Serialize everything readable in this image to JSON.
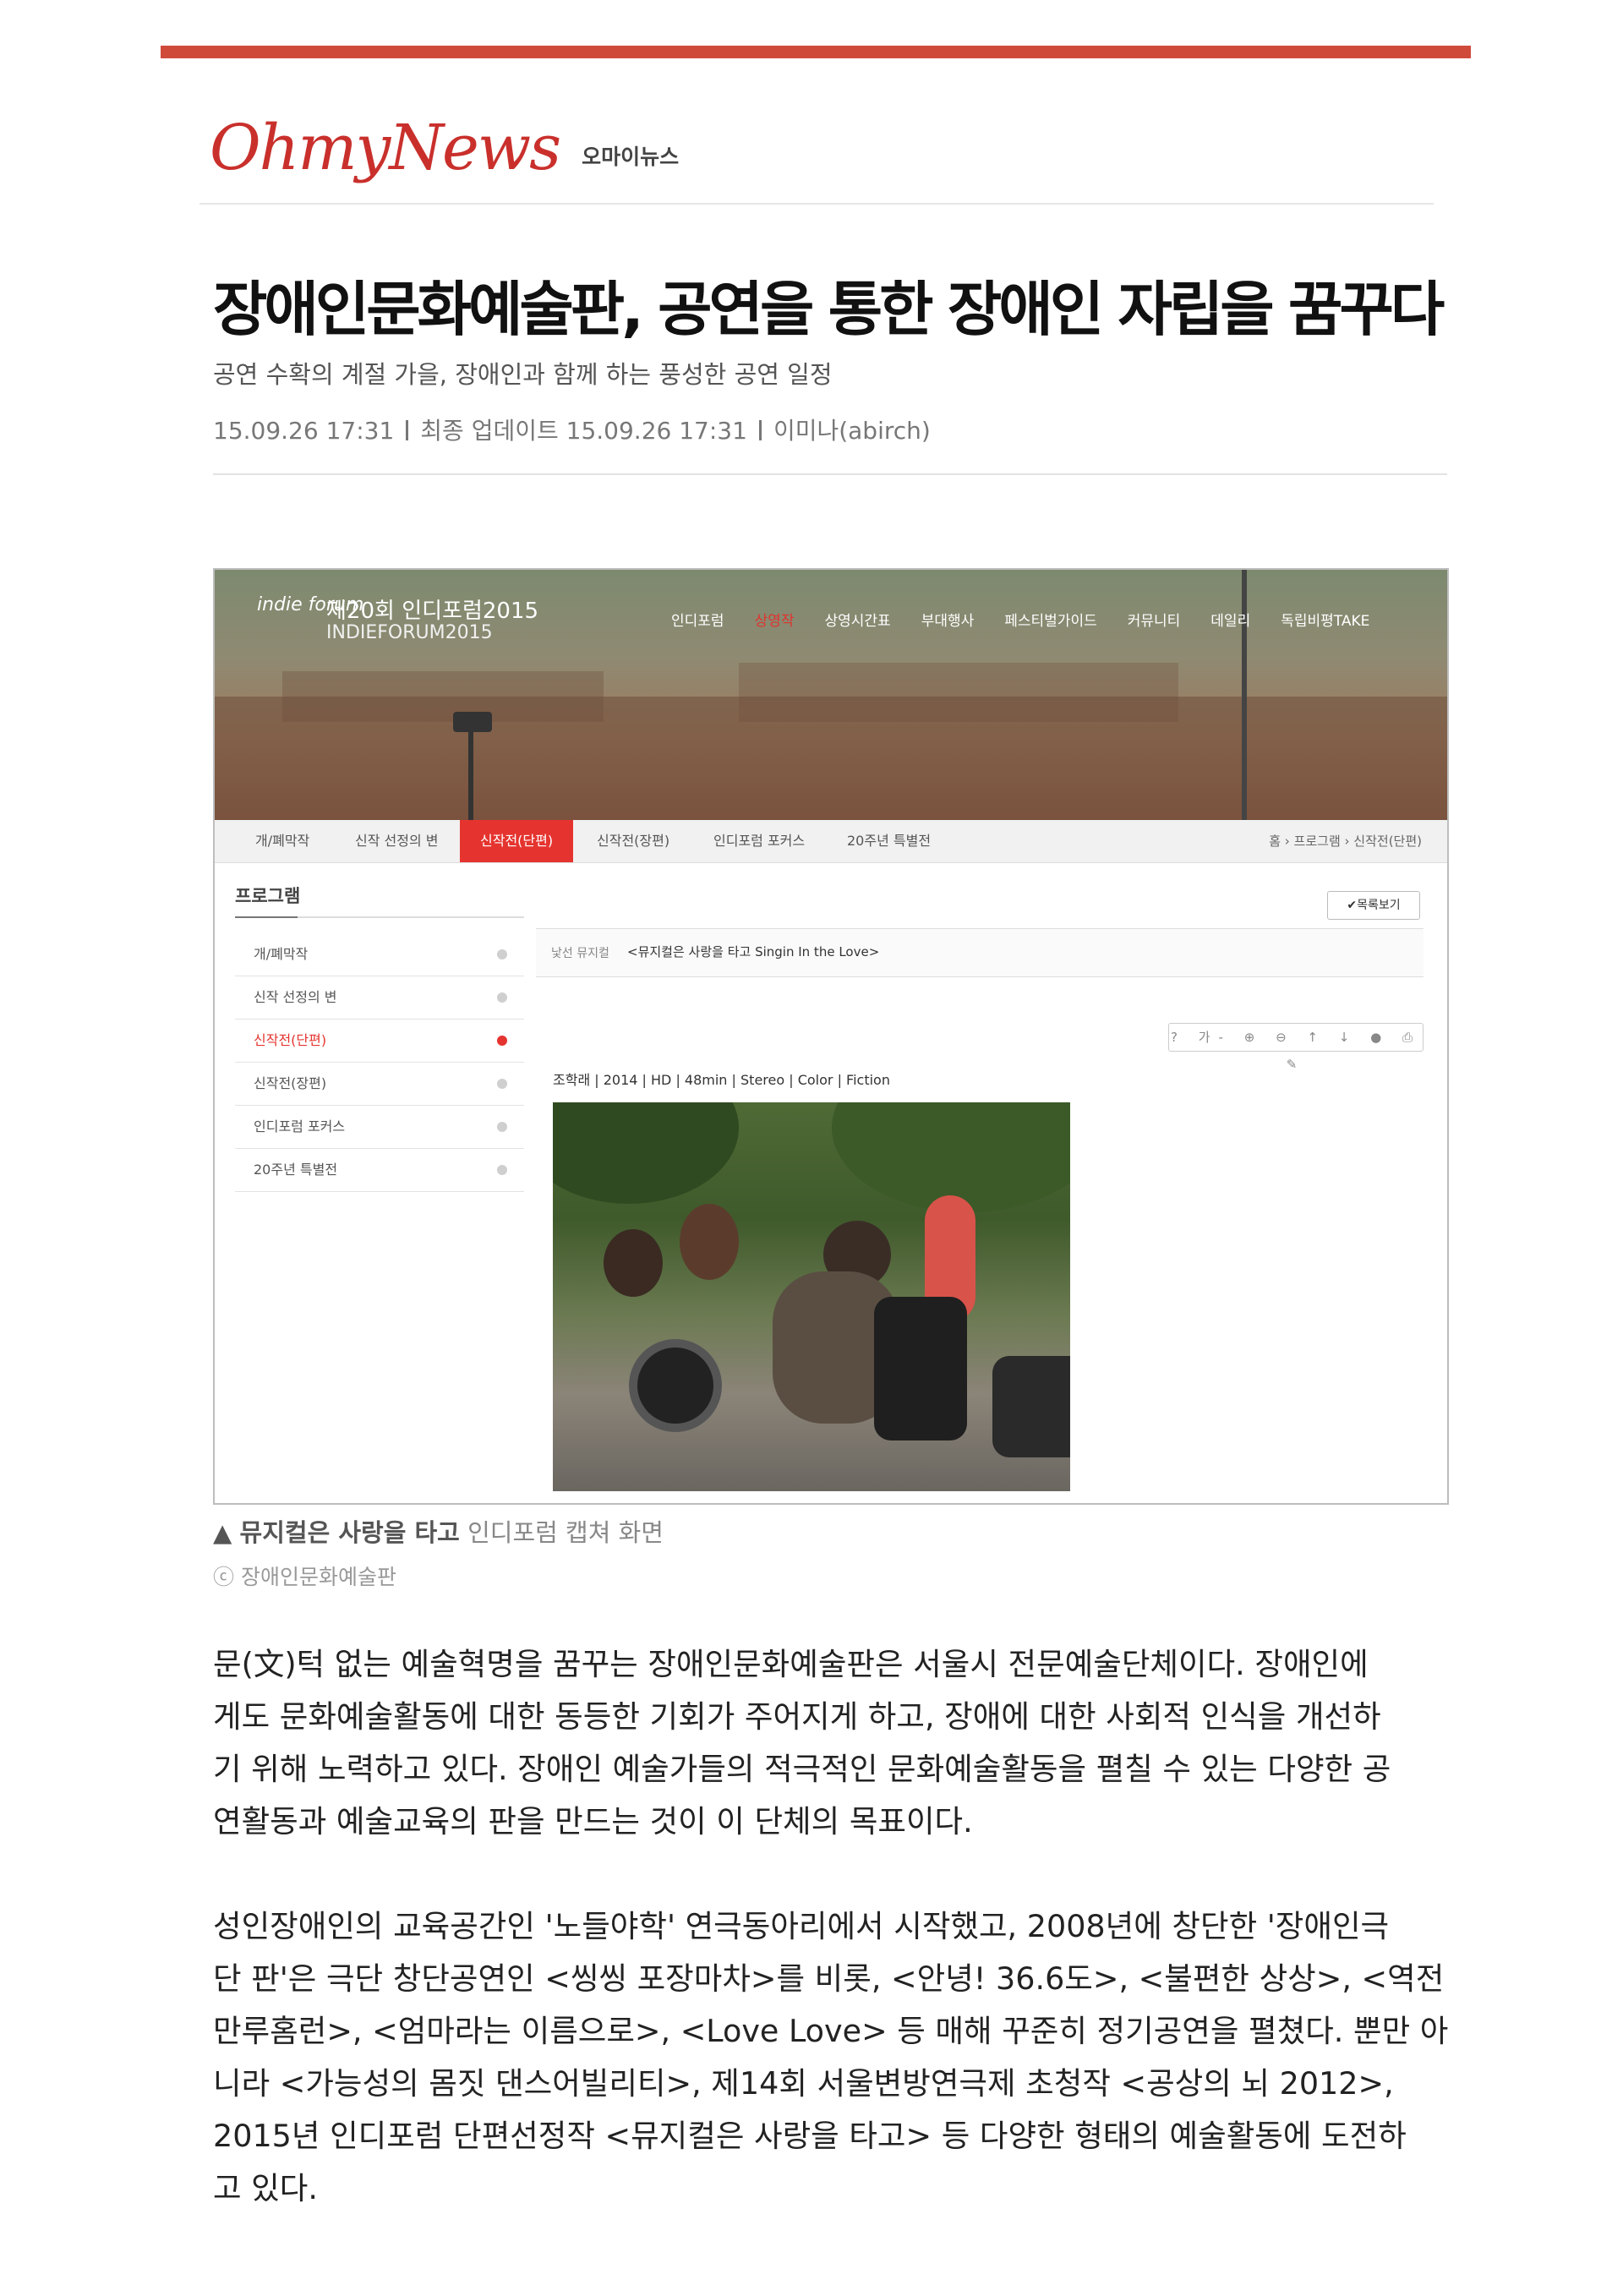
{
  "header": {
    "logo_text": "OhmyNews",
    "logo_korean": "오마이뉴스",
    "accent_color": "#d04a3a"
  },
  "article": {
    "title": "장애인문화예술판, 공연을 통한 장애인 자립을 꿈꾸다",
    "subtitle": "공연 수확의 계절 가을, 장애인과 함께 하는 풍성한 공연 일정",
    "published": "15.09.26 17:31",
    "updated": "최종 업데이트 15.09.26 17:31",
    "author": "이미나(abirch)"
  },
  "screenshot": {
    "site_logo": "indie forum",
    "site_title": "제20회 인디포럼2015",
    "site_subtitle": "INDIEFORUM2015",
    "nav": [
      "인디포럼",
      "상영작",
      "상영시간표",
      "부대행사",
      "페스티벌가이드",
      "커뮤니티",
      "데일리",
      "독립비평TAKE"
    ],
    "tabs": [
      "개/폐막작",
      "신작 선정의 변",
      "신작전(단편)",
      "신작전(장편)",
      "인디포럼 포커스",
      "20주년 특별전"
    ],
    "breadcrumb": "홈 › 프로그램 › 신작전(단편)",
    "sidebar_title": "프로그램",
    "sidebar_items": [
      "개/폐막작",
      "신작 선정의 변",
      "신작전(단편)",
      "신작전(장편)",
      "인디포럼 포커스",
      "20주년 특별전"
    ],
    "list_button": "✔목록보기",
    "film_category": "낯선 뮤지컬",
    "film_title": "<뮤지컬은 사랑을 타고 Singin In the Love>",
    "tools": "? 가- ⊕ ⊖ ↑ ↓ ● ⎙ ✎",
    "film_meta": "조학래 | 2014 | HD | 48min | Stereo | Color | Fiction"
  },
  "caption": {
    "marker": "▲",
    "bold": "뮤지컬은 사랑을 타고",
    "rest": "인디포럼 캡쳐 화면",
    "credit": "ⓒ 장애인문화예술판"
  },
  "body": {
    "p1": [
      "문(文)턱 없는 예술혁명을 꿈꾸는 장애인문화예술판은 서울시 전문예술단체이다. 장애인에",
      "게도 문화예술활동에 대한 동등한 기회가 주어지게 하고, 장애에 대한 사회적 인식을 개선하",
      "기 위해 노력하고 있다. 장애인 예술가들의 적극적인 문화예술활동을 펼칠 수 있는 다양한 공",
      "연활동과 예술교육의 판을 만드는 것이 이 단체의 목표이다."
    ],
    "p2": [
      "성인장애인의 교육공간인 '노들야학' 연극동아리에서 시작했고, 2008년에 창단한 '장애인극",
      "단 판'은 극단 창단공연인 <씽씽 포장마차>를 비롯, <안녕! 36.6도>, <불편한 상상>, <역전",
      "만루홈런>, <엄마라는 이름으로>, <Love Love> 등 매해 꾸준히 정기공연을 펼쳤다. 뿐만 아",
      "니라 <가능성의 몸짓 댄스어빌리티>, 제14회 서울변방연극제 초청작 <공상의 뇌 2012>,",
      "2015년 인디포럼 단편선정작 <뮤지컬은 사랑을 타고> 등 다양한 형태의 예술활동에 도전하",
      "고 있다."
    ]
  }
}
